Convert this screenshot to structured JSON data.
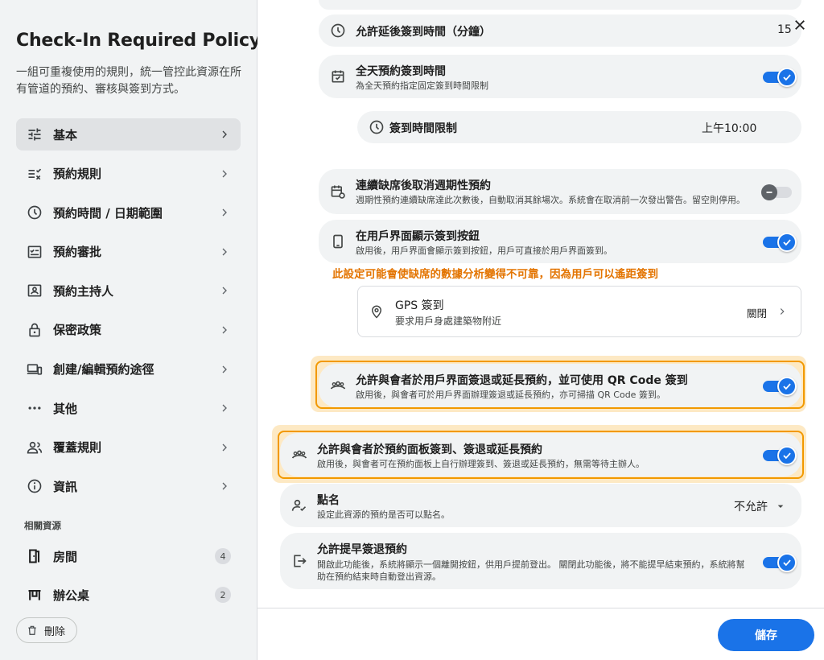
{
  "sidebar": {
    "title": "Check-In Required Policy",
    "description": "一組可重複使用的規則，統一管控此資源在所有管道的預約、審核與簽到方式。",
    "nav": [
      {
        "label": "基本",
        "icon": "tune-icon"
      },
      {
        "label": "預約規則",
        "icon": "rule-icon"
      },
      {
        "label": "預約時間 / 日期範圍",
        "icon": "clock-icon"
      },
      {
        "label": "預約審批",
        "icon": "approval-icon"
      },
      {
        "label": "預約主持人",
        "icon": "host-icon"
      },
      {
        "label": "保密政策",
        "icon": "lock-icon"
      },
      {
        "label": "創建/編輯預約途徑",
        "icon": "devices-icon"
      },
      {
        "label": "其他",
        "icon": "more-icon"
      },
      {
        "label": "覆蓋規則",
        "icon": "group-icon"
      },
      {
        "label": "資訊",
        "icon": "info-icon"
      }
    ],
    "resources_title": "相關資源",
    "resources": [
      {
        "label": "房間",
        "count": "4",
        "icon": "door-icon"
      },
      {
        "label": "辦公桌",
        "count": "2",
        "icon": "desk-icon"
      }
    ],
    "delete_label": "刪除"
  },
  "main": {
    "late_checkin": {
      "title": "允許延後簽到時間（分鐘）",
      "value": "15"
    },
    "allday": {
      "title": "全天預約簽到時間",
      "subtitle": "為全天預約指定固定簽到時間限制",
      "enabled": true
    },
    "checkin_limit": {
      "title": "簽到時間限制",
      "value": "上午10:00"
    },
    "cancel_recurring": {
      "title": "連續缺席後取消週期性預約",
      "subtitle": "週期性預約連續缺席達此次數後，自動取消其餘場次。系統會在取消前一次發出警告。留空則停用。",
      "enabled": false
    },
    "show_button": {
      "title": "在用戶界面顯示簽到按鈕",
      "subtitle": "啟用後，用戶界面會顯示簽到按鈕，用戶可直接於用戶界面簽到。",
      "enabled": true
    },
    "warning": "此設定可能會使缺席的數據分析變得不可靠，因為用戶可以遙距簽到",
    "gps": {
      "title": "GPS 簽到",
      "subtitle": "要求用戶身處建築物附近",
      "value": "關閉"
    },
    "qr": {
      "title": "允許與會者於用戶界面簽退或延長預約，並可使用 QR Code 簽到",
      "subtitle": "啟用後，與會者可於用戶界面辦理簽退或延長預約，亦可掃描 QR Code 簽到。",
      "enabled": true
    },
    "panel": {
      "title": "允許與會者於預約面板簽到、簽退或延長預約",
      "subtitle": "啟用後，與會者可在預約面板上自行辦理簽到、簽退或延長預約，無需等待主辦人。",
      "enabled": true
    },
    "rollcall": {
      "title": "點名",
      "subtitle": "設定此資源的預約是否可以點名。",
      "value": "不允許"
    },
    "early_checkout": {
      "title": "允許提早簽退預約",
      "subtitle_1": "開啟此功能後，系統將顯示一個離開按鈕，供用戶提前登出。 關閉此功能後，將不能提早結束預約，系統將幫",
      "subtitle_2": "助在預約結束時自動登出資源。",
      "enabled": true
    }
  },
  "footer": {
    "save_label": "儲存"
  },
  "colors": {
    "accent": "#1a73e8",
    "warning": "#e37400",
    "highlight_border": "#f29900"
  }
}
